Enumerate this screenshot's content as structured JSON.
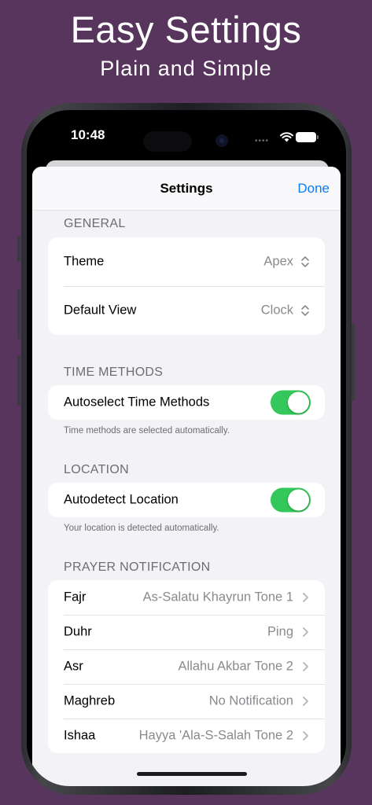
{
  "promo": {
    "title": "Easy Settings",
    "subtitle": "Plain and Simple"
  },
  "status_bar": {
    "time": "10:48",
    "signal": "••••"
  },
  "navbar": {
    "title": "Settings",
    "done_label": "Done"
  },
  "general": {
    "header": "GENERAL",
    "rows": [
      {
        "label": "Theme",
        "value": "Apex",
        "icon": "chevron-up-down-icon"
      },
      {
        "label": "Default View",
        "value": "Clock",
        "icon": "chevron-up-down-icon"
      }
    ]
  },
  "time_methods": {
    "header": "TIME METHODS",
    "label": "Autoselect Time Methods",
    "enabled": true,
    "footer": "Time methods are selected automatically."
  },
  "location": {
    "header": "LOCATION",
    "label": "Autodetect Location",
    "enabled": true,
    "footer": "Your location is detected automatically."
  },
  "prayer_notification": {
    "header": "PRAYER NOTIFICATION",
    "rows": [
      {
        "label": "Fajr",
        "value": "As-Salatu Khayrun Tone 1",
        "icon": "chevron-right-icon"
      },
      {
        "label": "Duhr",
        "value": "Ping",
        "icon": "chevron-right-icon"
      },
      {
        "label": "Asr",
        "value": "Allahu Akbar Tone 2",
        "icon": "chevron-right-icon"
      },
      {
        "label": "Maghreb",
        "value": "No Notification",
        "icon": "chevron-right-icon"
      },
      {
        "label": "Ishaa",
        "value": "Hayya 'Ala-S-Salah Tone 2",
        "icon": "chevron-right-icon"
      }
    ]
  },
  "colors": {
    "background": "#58355d",
    "accent": "#0a7cf5",
    "toggle_on": "#34c759"
  }
}
